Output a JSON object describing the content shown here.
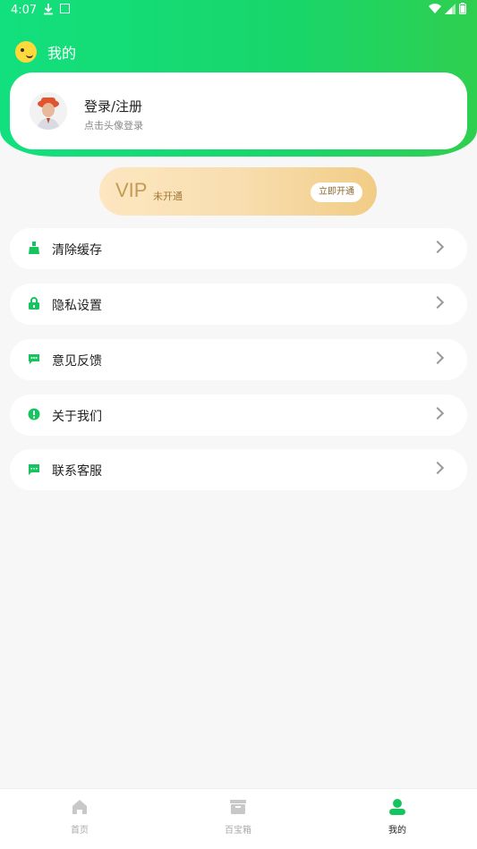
{
  "status_bar": {
    "time": "4:07"
  },
  "page": {
    "title": "我的"
  },
  "profile": {
    "title": "登录/注册",
    "subtitle": "点击头像登录"
  },
  "vip": {
    "label": "VIP",
    "status": "未开通",
    "button": "立即开通"
  },
  "menu": [
    {
      "label": "清除缓存",
      "icon": "broom-icon"
    },
    {
      "label": "隐私设置",
      "icon": "lock-icon"
    },
    {
      "label": "意见反馈",
      "icon": "message-icon"
    },
    {
      "label": "关于我们",
      "icon": "info-icon"
    },
    {
      "label": "联系客服",
      "icon": "chat-icon"
    }
  ],
  "bottom_nav": [
    {
      "label": "首页",
      "icon": "home-icon",
      "active": false
    },
    {
      "label": "百宝箱",
      "icon": "box-icon",
      "active": false
    },
    {
      "label": "我的",
      "icon": "user-icon",
      "active": true
    }
  ],
  "colors": {
    "accent": "#12c95f",
    "vip_text": "#c39a56"
  }
}
